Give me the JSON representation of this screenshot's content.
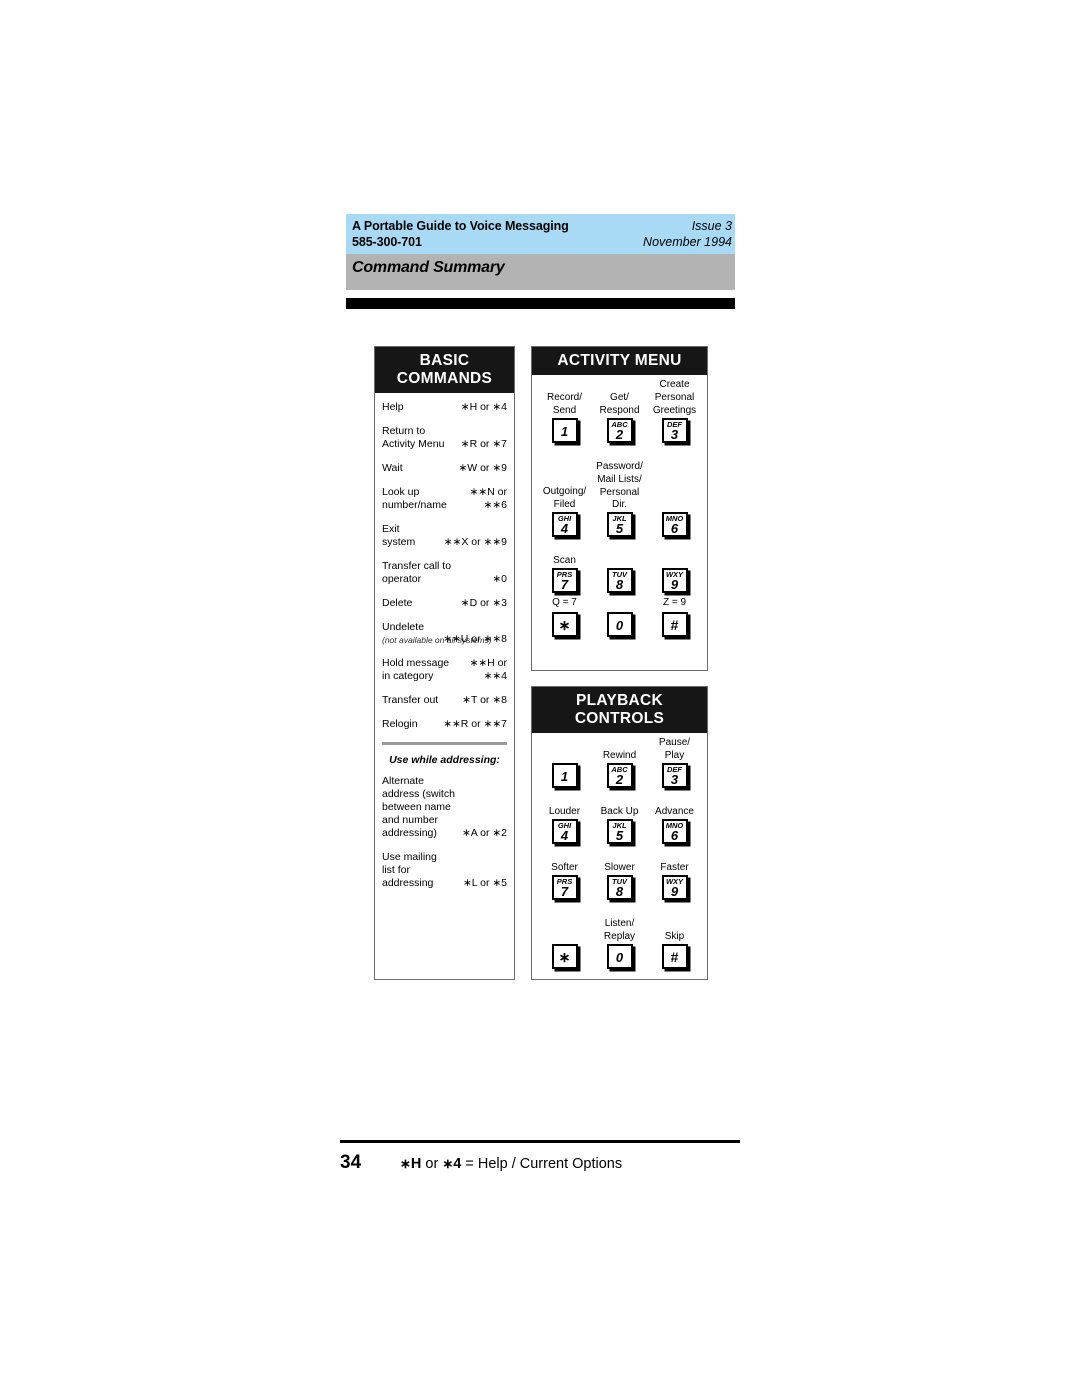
{
  "header": {
    "guide_title": "A Portable Guide to Voice Messaging",
    "doc_number": "585-300-701",
    "issue": "Issue 3",
    "date": "November 1994",
    "chapter_title": "Command Summary",
    "blue_color": "#a8daf5",
    "gray_color": "#b3b3b3"
  },
  "basic_commands": {
    "title_line1": "BASIC",
    "title_line2": "COMMANDS",
    "rows": [
      {
        "label": "Help",
        "code": "∗H or  ∗4"
      },
      {
        "label": "Return to\nActivity Menu",
        "code": "∗R or  ∗7"
      },
      {
        "label": "Wait",
        "code": "∗W or  ∗9"
      },
      {
        "label": "Look up\nnumber/name",
        "code": "∗∗N or\n∗∗6"
      },
      {
        "label": "Exit\nsystem",
        "code": "∗∗X or  ∗∗9"
      },
      {
        "label": "Transfer call to\noperator",
        "code": "∗0"
      },
      {
        "label": "Delete",
        "code": "∗D or  ∗3"
      },
      {
        "label": "Undelete",
        "code": "∗∗U or  ∗∗8",
        "note": "(not available on all systems)"
      },
      {
        "label": "Hold message\nin category",
        "code": "∗∗H or\n∗∗4"
      },
      {
        "label": "Transfer out",
        "code": "∗T or  ∗8"
      },
      {
        "label": "Relogin",
        "code": "∗∗R or  ∗∗7"
      }
    ],
    "subhead": "Use while addressing:",
    "addressing_rows": [
      {
        "label": "Alternate\naddress (switch\nbetween name\nand number\naddressing)",
        "code": "∗A or  ∗2"
      },
      {
        "label": "Use mailing\nlist for\naddressing",
        "code": "∗L or  ∗5"
      }
    ]
  },
  "activity_menu": {
    "title": "ACTIVITY MENU",
    "keys": [
      {
        "caption": "Record/\nSend",
        "letters": "",
        "digit": "1",
        "sub": ""
      },
      {
        "caption": "Get/\nRespond",
        "letters": "ABC",
        "digit": "2",
        "sub": ""
      },
      {
        "caption": "Create\nPersonal\nGreetings",
        "letters": "DEF",
        "digit": "3",
        "sub": ""
      },
      {
        "caption": "Outgoing/\nFiled",
        "letters": "GHI",
        "digit": "4",
        "sub": ""
      },
      {
        "caption": "Password/\nMail Lists/\nPersonal Dir.",
        "letters": "JKL",
        "digit": "5",
        "sub": ""
      },
      {
        "caption": "",
        "letters": "MNO",
        "digit": "6",
        "sub": ""
      },
      {
        "caption": "Scan",
        "letters": "PRS",
        "digit": "7",
        "sub": "Q = 7"
      },
      {
        "caption": "",
        "letters": "TUV",
        "digit": "8",
        "sub": ""
      },
      {
        "caption": "",
        "letters": "WXY",
        "digit": "9",
        "sub": "Z = 9"
      },
      {
        "caption": "",
        "letters": "",
        "digit": "∗",
        "sub": ""
      },
      {
        "caption": "",
        "letters": "",
        "digit": "0",
        "sub": ""
      },
      {
        "caption": "",
        "letters": "",
        "digit": "#",
        "sub": ""
      }
    ]
  },
  "playback_controls": {
    "title_line1": "PLAYBACK",
    "title_line2": "CONTROLS",
    "keys": [
      {
        "caption": "",
        "letters": "",
        "digit": "1",
        "sub": ""
      },
      {
        "caption": "Rewind",
        "letters": "ABC",
        "digit": "2",
        "sub": ""
      },
      {
        "caption": "Pause/\nPlay",
        "letters": "DEF",
        "digit": "3",
        "sub": ""
      },
      {
        "caption": "Louder",
        "letters": "GHI",
        "digit": "4",
        "sub": ""
      },
      {
        "caption": "Back Up",
        "letters": "JKL",
        "digit": "5",
        "sub": ""
      },
      {
        "caption": "Advance",
        "letters": "MNO",
        "digit": "6",
        "sub": ""
      },
      {
        "caption": "Softer",
        "letters": "PRS",
        "digit": "7",
        "sub": ""
      },
      {
        "caption": "Slower",
        "letters": "TUV",
        "digit": "8",
        "sub": ""
      },
      {
        "caption": "Faster",
        "letters": "WXY",
        "digit": "9",
        "sub": ""
      },
      {
        "caption": "",
        "letters": "",
        "digit": "∗",
        "sub": ""
      },
      {
        "caption": "Listen/\nReplay",
        "letters": "",
        "digit": "0",
        "sub": ""
      },
      {
        "caption": "Skip",
        "letters": "",
        "digit": "#",
        "sub": ""
      }
    ]
  },
  "footer": {
    "page_number": "34",
    "star1": "∗",
    "key1": "H",
    "or": " or ",
    "star2": "∗",
    "key2": "4",
    "equals": " = Help / Current Options"
  }
}
